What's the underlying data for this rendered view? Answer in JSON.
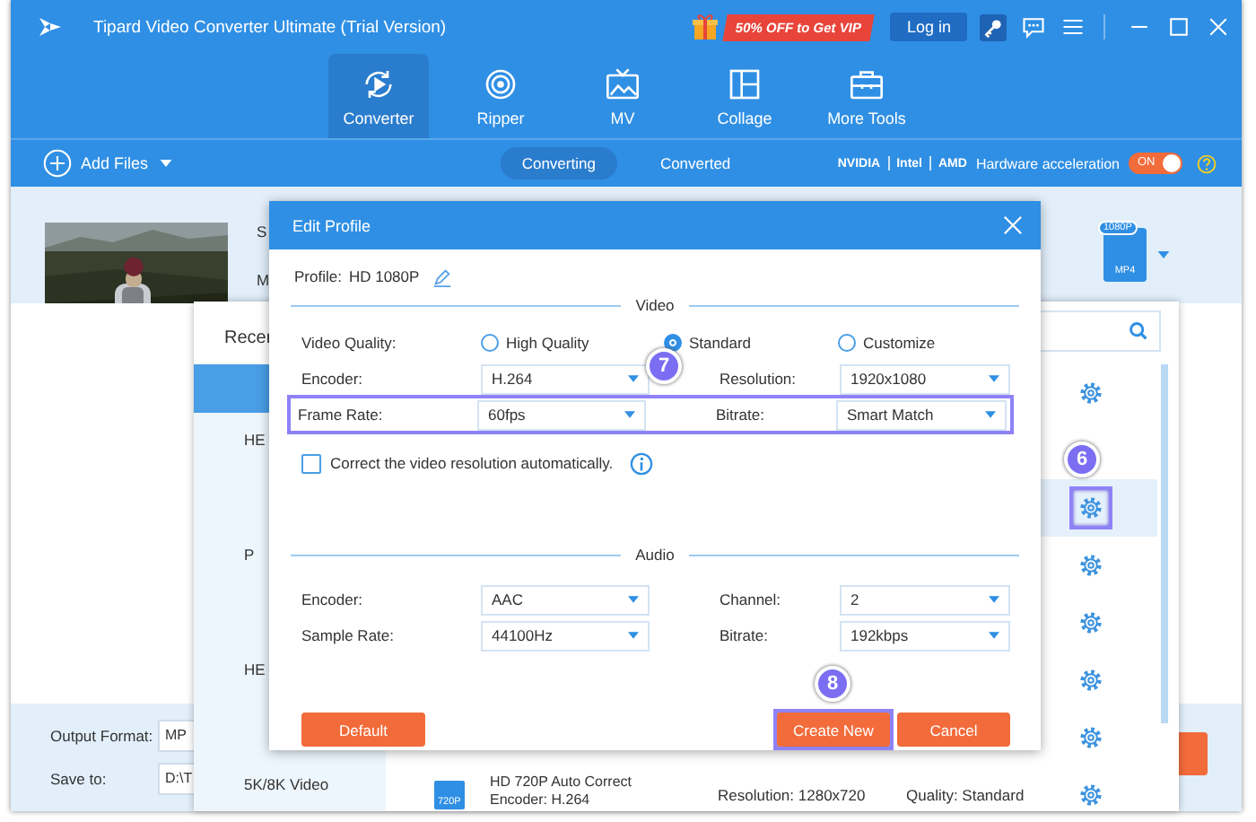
{
  "app": {
    "title": "Tipard Video Converter Ultimate (Trial Version)",
    "promo": "50% OFF to Get VIP",
    "login": "Log in"
  },
  "nav": [
    {
      "label": "Converter",
      "selected": true,
      "kind": "converter"
    },
    {
      "label": "Ripper",
      "selected": false,
      "kind": "ripper"
    },
    {
      "label": "MV",
      "selected": false,
      "kind": "mv"
    },
    {
      "label": "Collage",
      "selected": false,
      "kind": "collage"
    },
    {
      "label": "More Tools",
      "selected": false,
      "kind": "toolbox"
    }
  ],
  "toolbar": {
    "add_files": "Add Files",
    "tabs": [
      {
        "label": "Converting",
        "selected": true
      },
      {
        "label": "Converted",
        "selected": false
      }
    ],
    "gpu": [
      "NVIDIA",
      "Intel",
      "AMD"
    ],
    "hw_label": "Hardware acceleration",
    "hw_switch": {
      "label": "ON",
      "on": true
    }
  },
  "file": {
    "column_1": "S",
    "column_2": "M",
    "badge": "1080P",
    "format": "MP4"
  },
  "bottom": {
    "output_label": "Output Format:",
    "output_value": "MP",
    "save_label": "Save to:",
    "save_value": "D:\\T"
  },
  "format_panel": {
    "header": "Recer",
    "categories": [
      "HE",
      "P",
      "HE",
      "5K/8K Video"
    ],
    "profiles": [
      {
        "selected": false,
        "gear": true,
        "highlighted": false
      },
      {
        "selected": false,
        "gear": false
      },
      {
        "selected": true,
        "gear": true,
        "highlighted": true
      },
      {
        "selected": false,
        "gear": true,
        "highlighted": false
      },
      {
        "selected": false,
        "gear": true,
        "highlighted": false
      },
      {
        "selected": false,
        "gear": true,
        "highlighted": false
      },
      {
        "selected": false,
        "gear": true,
        "highlighted": false
      },
      {
        "selected": false,
        "gear": true,
        "highlighted": false,
        "badge": "720P",
        "name": "HD 720P Auto Correct",
        "encoder": "Encoder: H.264",
        "resolution": "Resolution: 1280x720",
        "quality": "Quality: Standard"
      }
    ]
  },
  "dialog": {
    "title": "Edit Profile",
    "profile_label": "Profile:",
    "profile_name": "HD 1080P",
    "video_heading": "Video",
    "quality_label": "Video Quality:",
    "quality_options": [
      {
        "label": "High Quality",
        "selected": false
      },
      {
        "label": "Standard",
        "selected": true
      },
      {
        "label": "Customize",
        "selected": false
      }
    ],
    "video_rows": [
      {
        "highlighted": false,
        "fields": [
          {
            "label": "Encoder:",
            "value": "H.264"
          },
          {
            "label": "Resolution:",
            "value": "1920x1080"
          }
        ]
      },
      {
        "highlighted": true,
        "fields": [
          {
            "label": "Frame Rate:",
            "value": "60fps"
          },
          {
            "label": "Bitrate:",
            "value": "Smart Match"
          }
        ]
      }
    ],
    "checkbox": {
      "label": "Correct the video resolution automatically.",
      "checked": false
    },
    "audio_heading": "Audio",
    "audio_fields": [
      {
        "label": "Encoder:",
        "value": "AAC"
      },
      {
        "label": "Channel:",
        "value": "2"
      },
      {
        "label": "Sample Rate:",
        "value": "44100Hz"
      },
      {
        "label": "Bitrate:",
        "value": "192kbps"
      }
    ],
    "buttons": [
      {
        "label": "Default",
        "kind": "default",
        "highlighted": false
      },
      {
        "label": "Create New",
        "kind": "primary",
        "highlighted": true
      },
      {
        "label": "Cancel",
        "kind": "cancel",
        "highlighted": false
      }
    ]
  },
  "annotations": [
    "6",
    "7",
    "8"
  ]
}
